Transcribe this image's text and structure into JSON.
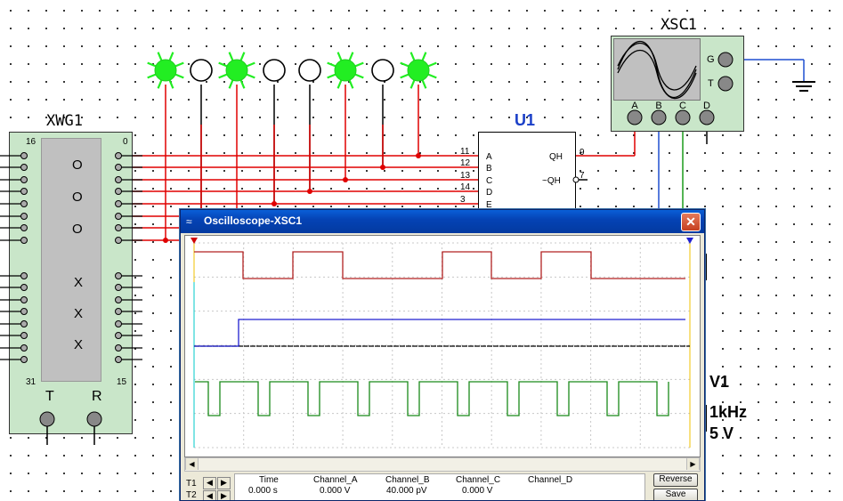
{
  "xwg1": {
    "label": "XWG1",
    "pin_top_left": "16",
    "pin_top_right": "0",
    "pin_bottom_left": "31",
    "pin_bottom_right": "15",
    "symbols": [
      "O",
      "O",
      "O",
      "X",
      "X",
      "X"
    ],
    "t_label": "T",
    "r_label": "R"
  },
  "xsc1": {
    "label": "XSC1",
    "g_label": "G",
    "t_label": "T",
    "channels": [
      "A",
      "B",
      "C",
      "D"
    ]
  },
  "u1": {
    "label": "U1",
    "pin_numbers": [
      "11",
      "12",
      "13",
      "14",
      "3"
    ],
    "inputs": [
      "A",
      "B",
      "C",
      "D",
      "E"
    ],
    "qh_pin": "9",
    "qh_label": "QH",
    "nqh_pin": "7",
    "nqh_label": "~QH"
  },
  "probes": [
    "on",
    "off",
    "on",
    "off",
    "off",
    "on",
    "off",
    "on"
  ],
  "v1": {
    "name": "V1",
    "freq": "1kHz",
    "volt": "5 V"
  },
  "oscilloscope": {
    "title": "Oscilloscope-XSC1",
    "close": "✕",
    "headers": [
      "Time",
      "Channel_A",
      "Channel_B",
      "Channel_C",
      "Channel_D"
    ],
    "t1_label": "T1",
    "t2_label": "T2",
    "t1_values": [
      "0.000 s",
      "0.000 V",
      "40.000 pV",
      "0.000 V",
      ""
    ],
    "reverse": "Reverse",
    "save": "Save",
    "colors": {
      "channel_a": "#b22222",
      "channel_b": "#1f1fd0",
      "channel_c": "#1a8a1a",
      "trace_bg": "#ffffff"
    }
  }
}
